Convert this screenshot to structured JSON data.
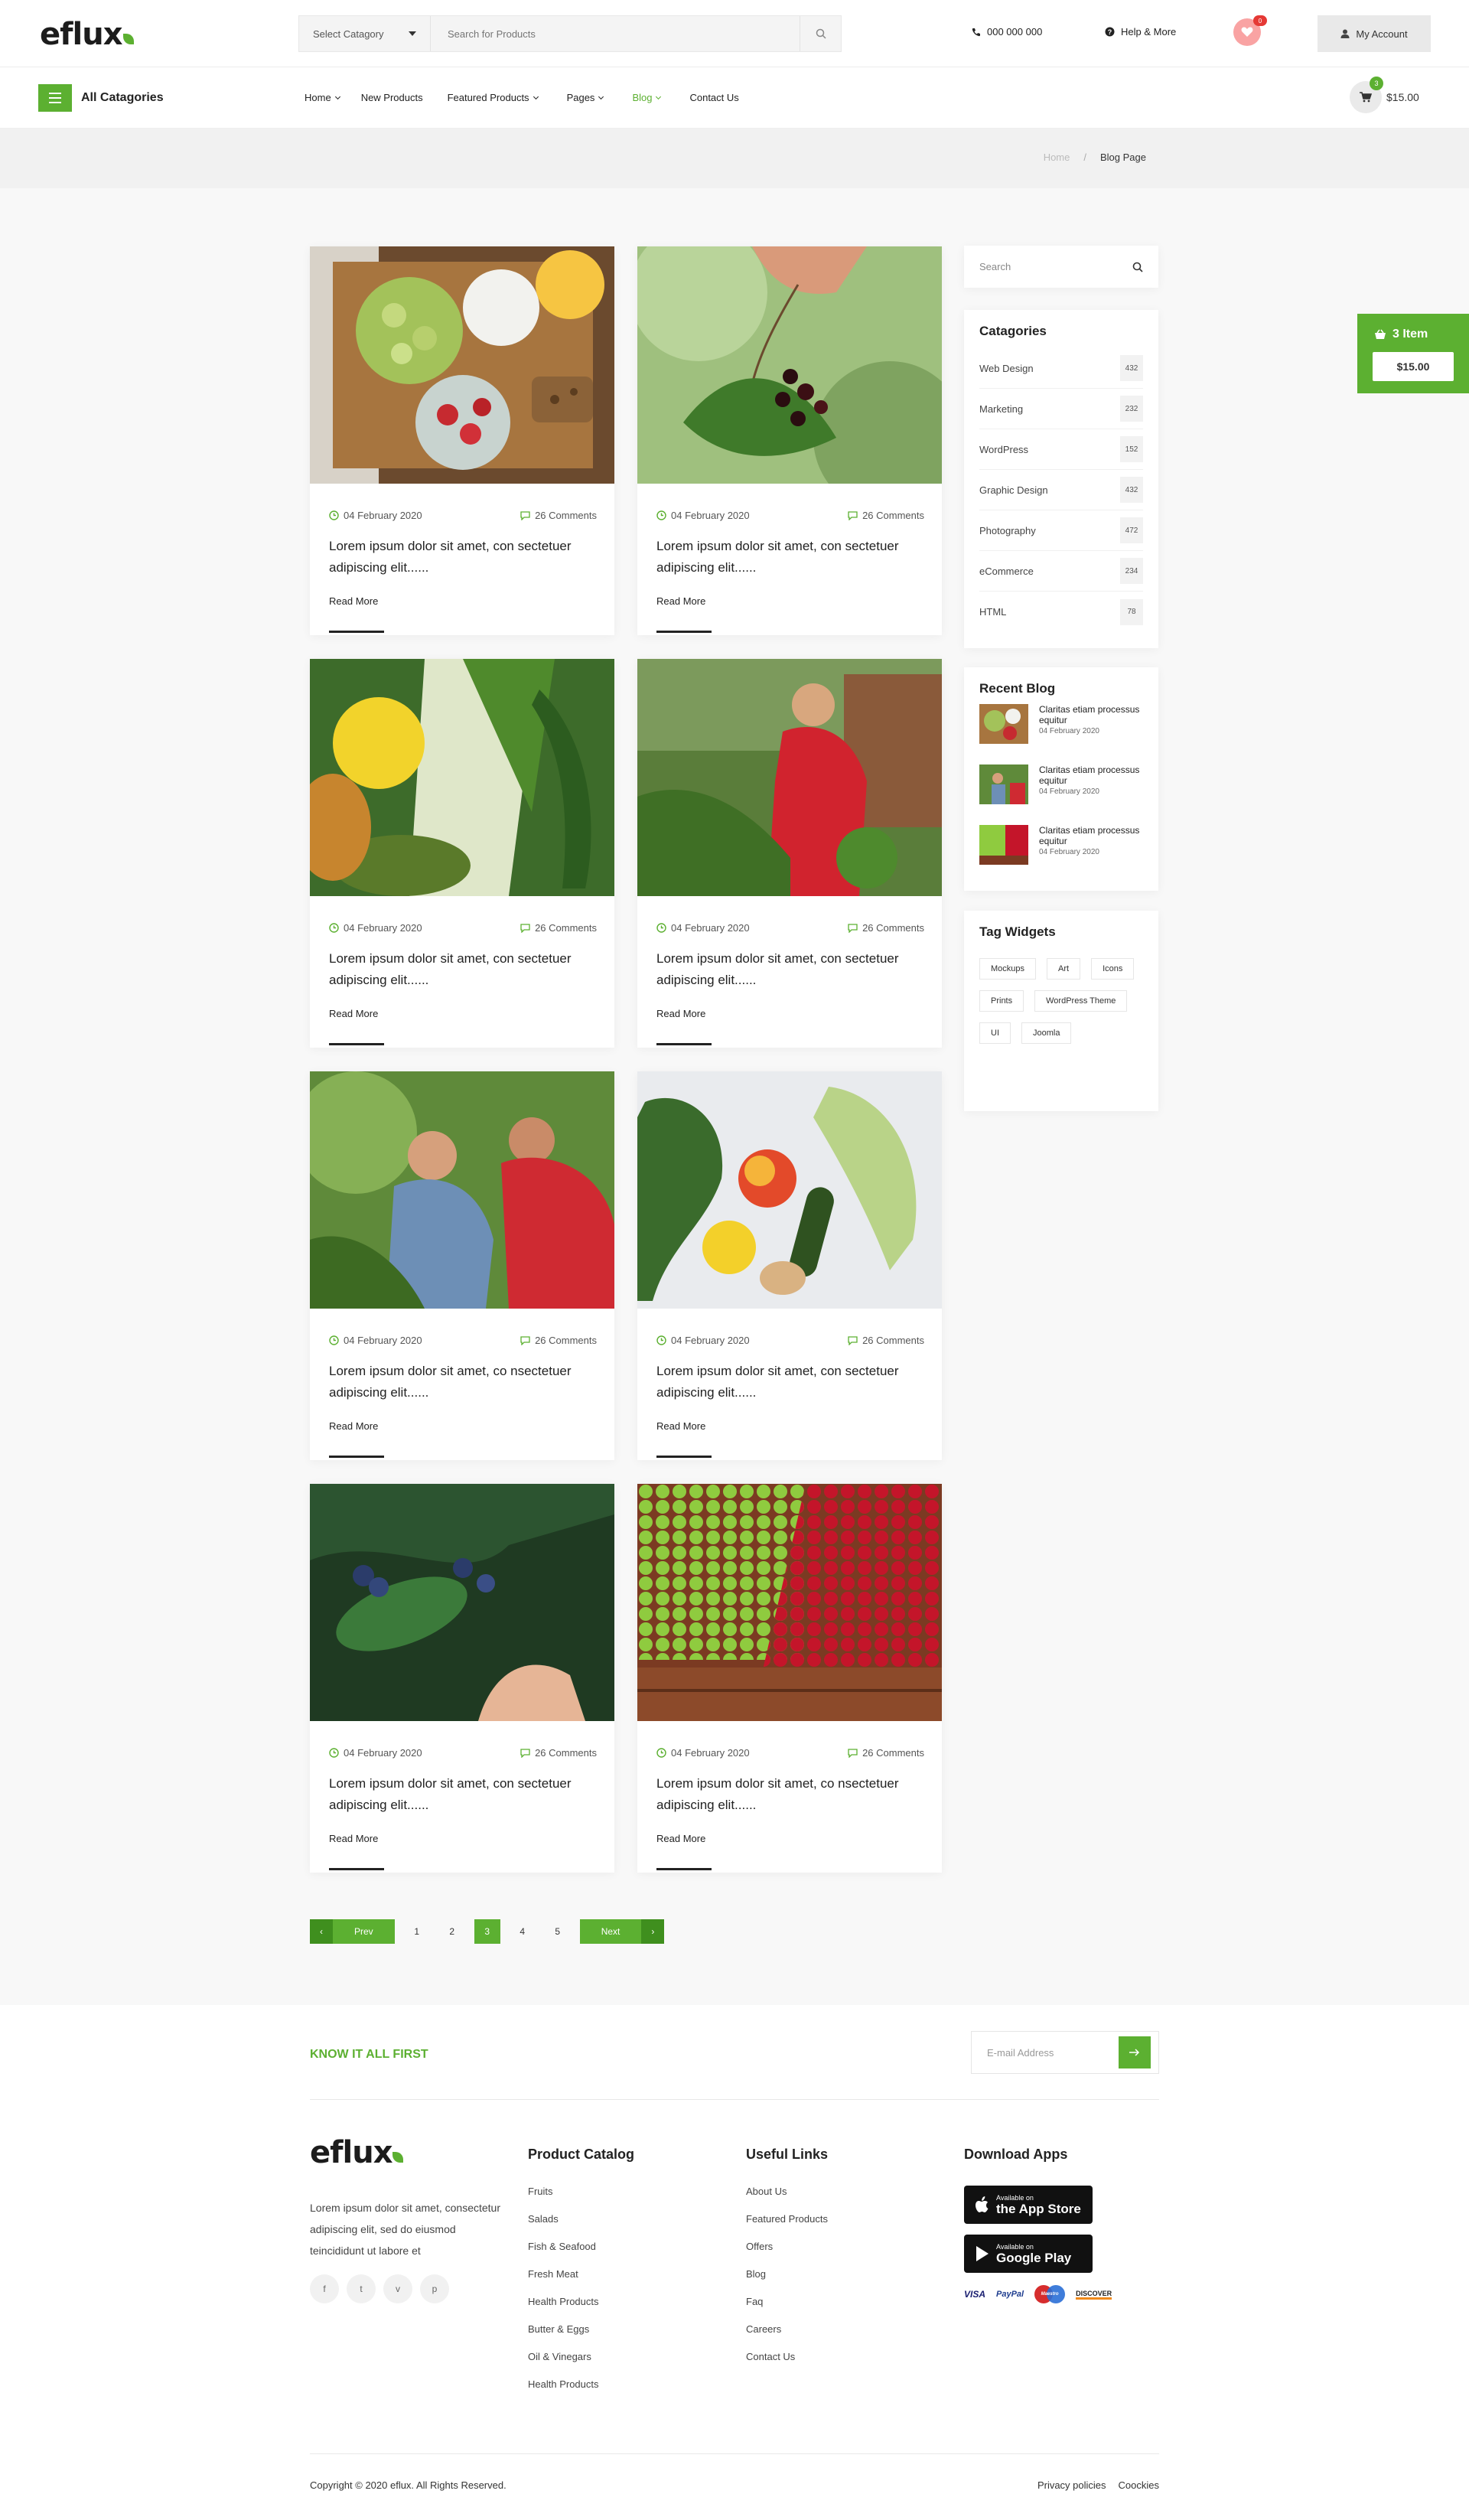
{
  "brand": {
    "logo_text": "eflu",
    "logo_x": "x",
    "accent": "#5cb031"
  },
  "header": {
    "category_select": "Select Catagory",
    "search_placeholder": "Search for Products",
    "phone": "000 000 000",
    "help": "Help & More",
    "wishlist_count": "0",
    "account": "My Account"
  },
  "nav": {
    "all_categories": "All Catagories",
    "items": [
      {
        "label": "Home",
        "dropdown": true
      },
      {
        "label": "New Products",
        "dropdown": false
      },
      {
        "label": "Featured Products",
        "dropdown": true
      },
      {
        "label": "Pages",
        "dropdown": true
      },
      {
        "label": "Blog",
        "dropdown": true,
        "active": true
      },
      {
        "label": "Contact Us",
        "dropdown": false
      }
    ],
    "cart_count": "3",
    "cart_total": "$15.00"
  },
  "breadcrumb": {
    "home": "Home",
    "separator": "/",
    "current": "Blog Page"
  },
  "posts": [
    {
      "date": "04 February 2020",
      "comments": "26 Comments",
      "title": "Lorem ipsum dolor sit amet, con sectetuer adipiscing elit......",
      "read_more": "Read More"
    },
    {
      "date": "04 February 2020",
      "comments": "26 Comments",
      "title": "Lorem ipsum dolor sit amet, con sectetuer adipiscing elit......",
      "read_more": "Read More"
    },
    {
      "date": "04 February 2020",
      "comments": "26 Comments",
      "title": "Lorem ipsum dolor sit amet, con sectetuer adipiscing elit......",
      "read_more": "Read More"
    },
    {
      "date": "04 February 2020",
      "comments": "26 Comments",
      "title": "Lorem ipsum dolor sit amet, con sectetuer adipiscing elit......",
      "read_more": "Read More"
    },
    {
      "date": "04 February 2020",
      "comments": "26 Comments",
      "title": "Lorem ipsum dolor sit amet, co nsectetuer adipiscing elit......",
      "read_more": "Read More"
    },
    {
      "date": "04 February 2020",
      "comments": "26 Comments",
      "title": "Lorem ipsum dolor sit amet, con sectetuer adipiscing elit......",
      "read_more": "Read More"
    },
    {
      "date": "04 February 2020",
      "comments": "26 Comments",
      "title": "Lorem ipsum dolor sit amet, con sectetuer adipiscing elit......",
      "read_more": "Read More"
    },
    {
      "date": "04 February 2020",
      "comments": "26 Comments",
      "title": "Lorem ipsum dolor sit amet, co nsectetuer adipiscing elit......",
      "read_more": "Read More"
    }
  ],
  "pagination": {
    "prev": "Prev",
    "pages": [
      "1",
      "2",
      "3",
      "4",
      "5"
    ],
    "current": "3",
    "next": "Next"
  },
  "sidebar": {
    "search_placeholder": "Search",
    "categories_title": "Catagories",
    "categories": [
      {
        "name": "Web Design",
        "count": "432"
      },
      {
        "name": "Marketing",
        "count": "232"
      },
      {
        "name": "WordPress",
        "count": "152"
      },
      {
        "name": "Graphic Design",
        "count": "432"
      },
      {
        "name": "Photography",
        "count": "472"
      },
      {
        "name": "eCommerce",
        "count": "234"
      },
      {
        "name": "HTML",
        "count": "78"
      }
    ],
    "recent_title": "Recent Blog",
    "recent": [
      {
        "title": "Claritas etiam processus equitur",
        "date": "04 February 2020"
      },
      {
        "title": "Claritas etiam processus equitur",
        "date": "04 February 2020"
      },
      {
        "title": "Claritas etiam processus equitur",
        "date": "04 February 2020"
      }
    ],
    "tags_title": "Tag Widgets",
    "tags": [
      "Mockups",
      "Art",
      "Icons",
      "Prints",
      "WordPress Theme",
      "UI",
      "Joomla"
    ]
  },
  "mini_cart": {
    "items": "3 Item",
    "total": "$15.00"
  },
  "footer": {
    "newsletter": "KNOW IT ALL FIRST",
    "email_placeholder": "E-mail Address",
    "about": "Lorem ipsum dolor sit amet, consectetur adipiscing elit, sed do eiusmod teincididunt ut labore et",
    "socials": [
      "f",
      "t",
      "v",
      "p"
    ],
    "catalog_title": "Product Catalog",
    "catalog": [
      "Fruits",
      "Salads",
      "Fish & Seafood",
      "Fresh Meat",
      "Health Products",
      "Butter & Eggs",
      "Oil & Vinegars",
      "Health Products"
    ],
    "links_title": "Useful Links",
    "links": [
      "About Us",
      "Featured Products",
      "Offers",
      "Blog",
      "Faq",
      "Careers",
      "Contact Us"
    ],
    "apps_title": "Download Apps",
    "app_store": {
      "small": "Available on",
      "big": "the App Store"
    },
    "google_play": {
      "small": "Available on",
      "big": "Google Play"
    },
    "payments": [
      "VISA",
      "PayPal",
      "Maestro",
      "DISCOVER"
    ],
    "copyright": "Copyright © 2020 eflux. All Rights Reserved.",
    "privacy": "Privacy policies",
    "cookies": "Coockies"
  }
}
